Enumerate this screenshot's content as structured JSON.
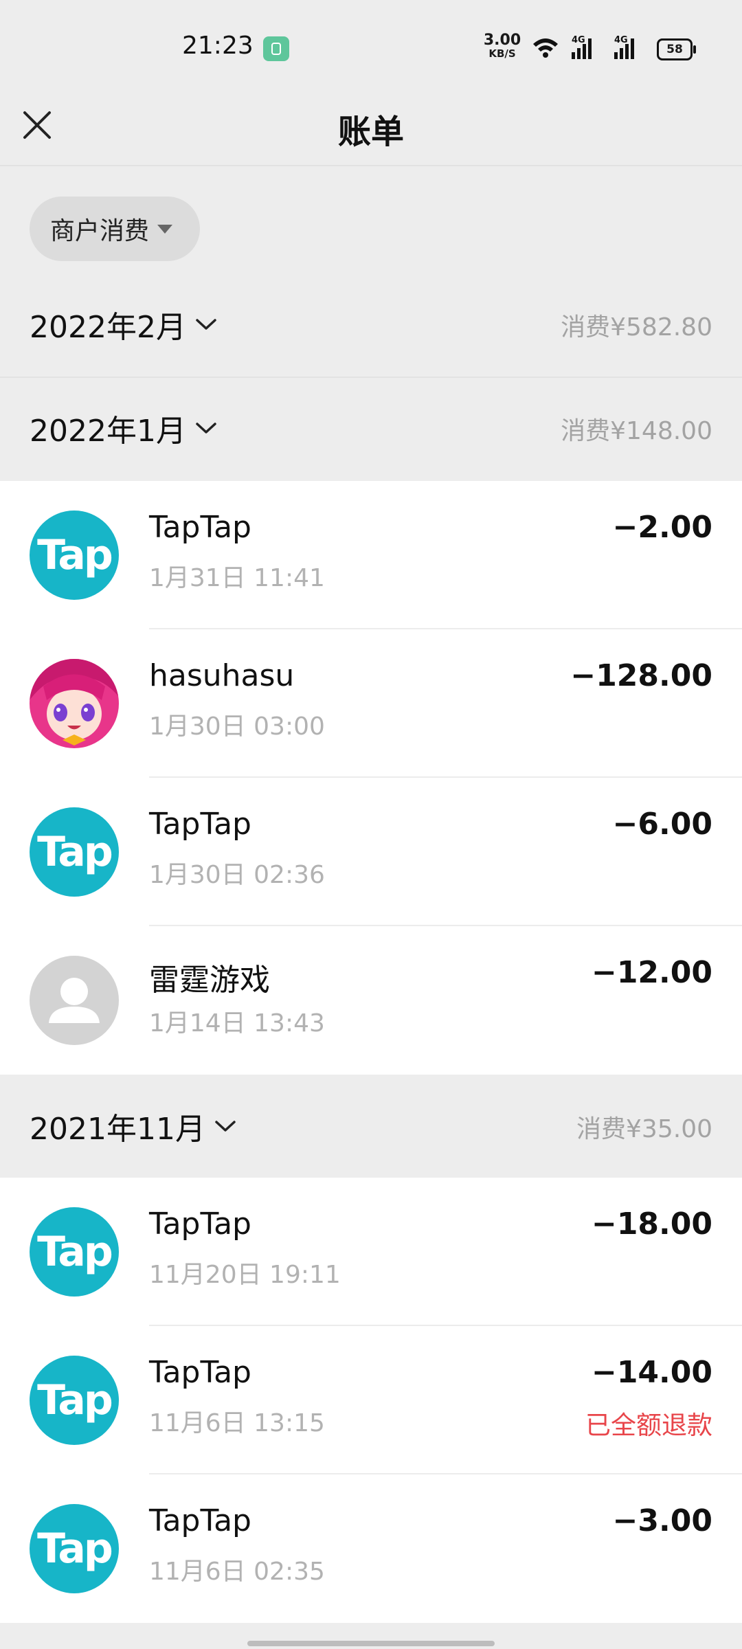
{
  "status_bar": {
    "time": "21:23",
    "net_speed_value": "3.00",
    "net_speed_unit": "KB/S",
    "network_1": "4G",
    "network_2": "4G",
    "battery": "58"
  },
  "nav": {
    "title": "账单",
    "close_icon": "close-icon"
  },
  "filter": {
    "label": "商户消费"
  },
  "months": [
    {
      "label": "2022年2月",
      "total": "消费¥582.80",
      "items": []
    },
    {
      "label": "2022年1月",
      "total": "消费¥148.00",
      "items": [
        {
          "name": "TapTap",
          "time": "1月31日 11:41",
          "amount": "−2.00",
          "avatar": "Tap",
          "refund": ""
        },
        {
          "name": "hasuhasu",
          "time": "1月30日 03:00",
          "amount": "−128.00",
          "avatar": "anime-avatar",
          "refund": ""
        },
        {
          "name": "TapTap",
          "time": "1月30日 02:36",
          "amount": "−6.00",
          "avatar": "Tap",
          "refund": ""
        },
        {
          "name": "雷霆游戏",
          "time": "1月14日 13:43",
          "amount": "−12.00",
          "avatar": "default-user-icon",
          "refund": ""
        }
      ]
    },
    {
      "label": "2021年11月",
      "total": "消费¥35.00",
      "items": [
        {
          "name": "TapTap",
          "time": "11月20日 19:11",
          "amount": "−18.00",
          "avatar": "Tap",
          "refund": ""
        },
        {
          "name": "TapTap",
          "time": "11月6日 13:15",
          "amount": "−14.00",
          "avatar": "Tap",
          "refund": "已全额退款"
        },
        {
          "name": "TapTap",
          "time": "11月6日 02:35",
          "amount": "−3.00",
          "avatar": "Tap",
          "refund": ""
        }
      ]
    }
  ],
  "colors": {
    "background": "#ededed",
    "taptap_brand": "#17b5c8",
    "refund_red": "#e8454a",
    "muted_text": "#b2b2b2"
  }
}
